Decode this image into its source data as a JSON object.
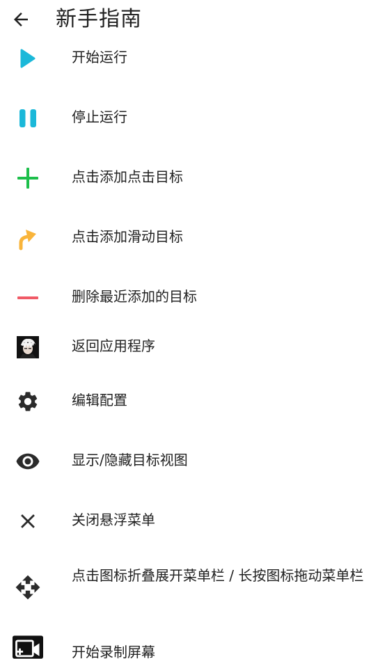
{
  "header": {
    "back_icon": "arrow-left-icon",
    "title": "新手指南"
  },
  "colors": {
    "play": "#1BB8D9",
    "pause": "#1BB8D9",
    "add": "#1DBF4B",
    "swipe": "#F9B43A",
    "remove": "#F05A66",
    "dark": "#2B2B2B"
  },
  "items": [
    {
      "icon": "play-icon",
      "label": "开始运行"
    },
    {
      "icon": "pause-icon",
      "label": "停止运行"
    },
    {
      "icon": "plus-icon",
      "label": "点击添加点击目标"
    },
    {
      "icon": "swipe-arrow-icon",
      "label": "点击添加滑动目标"
    },
    {
      "icon": "minus-icon",
      "label": "删除最近添加的目标"
    },
    {
      "icon": "app-avatar-icon",
      "label": "返回应用程序"
    },
    {
      "icon": "gear-icon",
      "label": "编辑配置"
    },
    {
      "icon": "eye-icon",
      "label": "显示/隐藏目标视图"
    },
    {
      "icon": "close-icon",
      "label": "关闭悬浮菜单"
    },
    {
      "icon": "move-icon",
      "label": "点击图标折叠展开菜单栏 / 长按图标拖动菜单栏"
    },
    {
      "icon": "record-screen-icon",
      "label": "开始录制屏幕"
    }
  ]
}
